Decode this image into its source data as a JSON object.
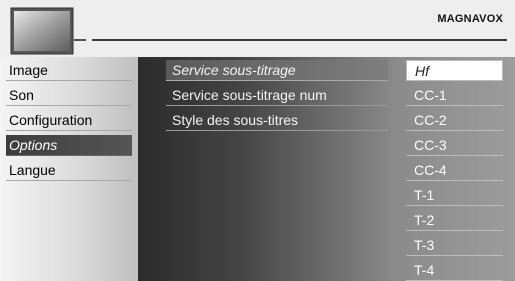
{
  "header": {
    "brand": "MAGNAVOX",
    "icon": "tv-icon"
  },
  "menu": {
    "items": [
      {
        "label": "Image"
      },
      {
        "label": "Son"
      },
      {
        "label": "Configuration"
      },
      {
        "label": "Options",
        "active": true
      },
      {
        "label": "Langue"
      }
    ]
  },
  "submenu": {
    "items": [
      {
        "label": "Service sous-titrage",
        "active": true
      },
      {
        "label": "Service sous-titrage num"
      },
      {
        "label": "Style des sous-titres"
      }
    ]
  },
  "options": {
    "items": [
      {
        "label": "Hf",
        "selected": true
      },
      {
        "label": "CC-1"
      },
      {
        "label": "CC-2"
      },
      {
        "label": "CC-3"
      },
      {
        "label": "CC-4"
      },
      {
        "label": "T-1"
      },
      {
        "label": "T-2"
      },
      {
        "label": "T-3"
      },
      {
        "label": "T-4"
      }
    ]
  }
}
